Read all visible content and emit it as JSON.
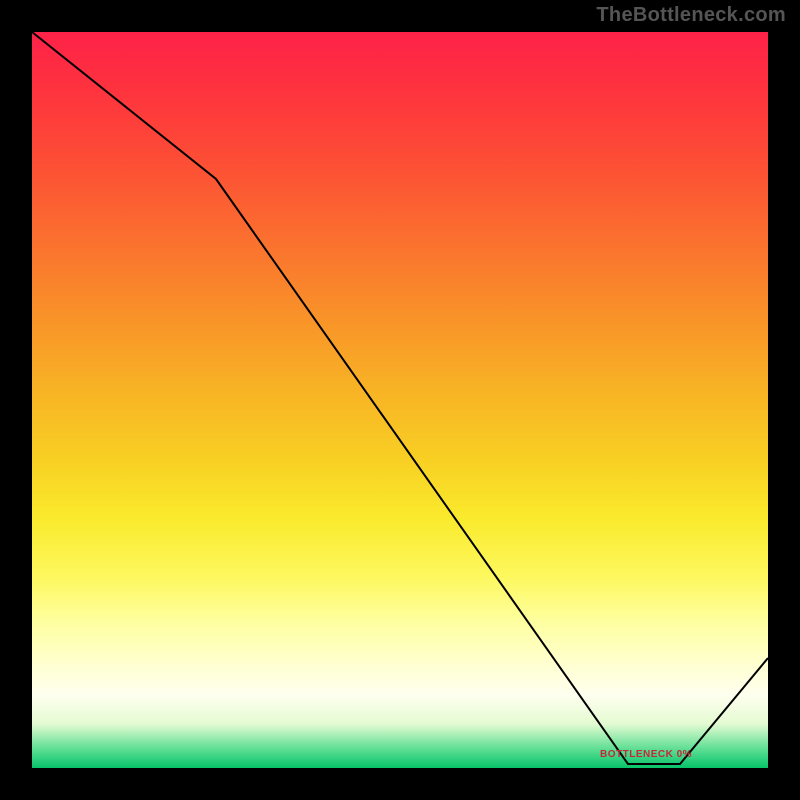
{
  "attribution": "TheBottleneck.com",
  "bottleneck_label": "BOTTLENECK 0%",
  "chart_data": {
    "type": "line",
    "title": "",
    "xlabel": "",
    "ylabel": "",
    "xlim": [
      0,
      100
    ],
    "ylim": [
      0,
      100
    ],
    "x": [
      0,
      25,
      81,
      88,
      100
    ],
    "values": [
      100,
      80,
      0.5,
      0.5,
      15
    ],
    "gradient_stops": [
      {
        "pct": 0,
        "color": "#fe2248"
      },
      {
        "pct": 50,
        "color": "#f8c024"
      },
      {
        "pct": 85,
        "color": "#ffffe0"
      },
      {
        "pct": 100,
        "color": "#09c46a"
      }
    ],
    "annotation": {
      "text": "BOTTLENECK 0%",
      "x": 84,
      "y": 2
    }
  }
}
